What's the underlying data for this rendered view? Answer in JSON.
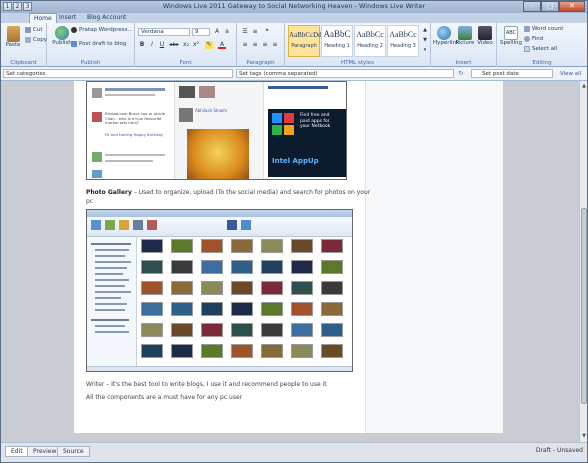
{
  "title": "Windows Live 2011 Gateway to Social Networking Heaven - Windows Live Writer",
  "qat": {
    "k1": "1",
    "k2": "2",
    "k3": "3"
  },
  "tabs": {
    "home": "Home",
    "home_key": "H",
    "insert": "Insert",
    "insert_key": "N",
    "blog_account": "Blog Account",
    "blog_account_key": "B"
  },
  "ribbon": {
    "paste": "Paste",
    "cut": "Cut",
    "copy": "Copy",
    "clipboard": "Clipboard",
    "publish": "Publish",
    "blog_name": "Pratap Wordpress...",
    "post_draft": "Post draft to blog",
    "publish_group": "Publish",
    "font_name": "Verdana",
    "font_size": "9",
    "bold": "B",
    "italic": "I",
    "underline": "U",
    "strike": "abc",
    "sub": "x₂",
    "sup": "x²",
    "font_group": "Font",
    "paragraph_group": "Paragraph",
    "styles": [
      {
        "sample": "AaBbCcDd",
        "name": "Paragraph"
      },
      {
        "sample": "AaBbC",
        "name": "Heading 1"
      },
      {
        "sample": "AaBbCc",
        "name": "Heading 2"
      },
      {
        "sample": "AaBbCc",
        "name": "Heading 3"
      }
    ],
    "styles_group": "HTML styles",
    "hyperlink": "Hyperlink",
    "picture": "Picture",
    "video": "Video",
    "insert_group": "Insert",
    "spelling": "Spelling",
    "word_count": "Word count",
    "find": "Find",
    "select_all": "Select all",
    "editing_group": "Editing"
  },
  "propbar": {
    "categories": "Set categories",
    "tags": "Set tags (comma separated)",
    "post_date": "Set post date",
    "view_all": "View all"
  },
  "doc": {
    "caption_gallery_bold": "Photo Gallery",
    "caption_gallery_rest": " – Used to organize, upload (To the social media) and search for photos on your",
    "caption_gallery_line2": "pc",
    "writer_line": "Writer – It's the best tool to write blogs, I use it and recommend people to use it",
    "all_components": "All the components are a must have for any pc user",
    "shot1": {
      "ad_line1": "Find free and",
      "ad_line2": "paid apps for",
      "ad_line3": "your Netbook",
      "ad_brand": "Intel AppUp",
      "name": "Abhilash Shaahi",
      "entry1": "Bindaa.com Bruce Lee or Jackie Chan - who is a true favourite martial arts hero?",
      "entry2": "Fit and trailing Happy Birthday"
    }
  },
  "bottom": {
    "edit": "Edit",
    "preview": "Preview",
    "source": "Source",
    "status": "Draft - Unsaved"
  },
  "colors": {
    "ribbon_top": "#f3f6fb",
    "ribbon_bottom": "#dce6f4",
    "accent": "#3e6aaa",
    "selected_style": "#ffe59a"
  }
}
